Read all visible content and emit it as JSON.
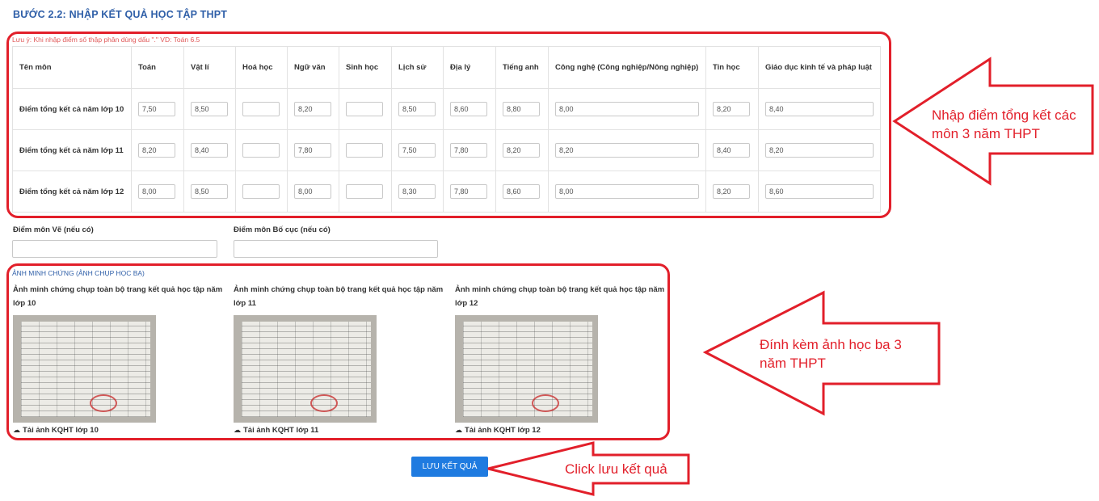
{
  "header": {
    "step_title": "BƯỚC 2.2: NHẬP KẾT QUẢ HỌC TẬP THPT"
  },
  "note": "Lưu ý: Khi nhập điểm số thập phân dùng dấu \".\" VD: Toán 6.5",
  "table": {
    "headers": [
      "Tên môn",
      "Toán",
      "Vật lí",
      "Hoá học",
      "Ngữ văn",
      "Sinh học",
      "Lịch sử",
      "Địa lý",
      "Tiếng anh",
      "Công nghệ (Công nghiệp/Nông nghiệp)",
      "Tin học",
      "Giáo dục kinh tế và pháp luật"
    ],
    "rows": [
      {
        "label": "Điểm tổng kết cả năm lớp 10",
        "values": [
          "7,50",
          "8,50",
          "",
          "8,20",
          "",
          "8,50",
          "8,60",
          "8,80",
          "8,00",
          "8,20",
          "8,40"
        ]
      },
      {
        "label": "Điểm tổng kết cả năm lớp 11",
        "values": [
          "8,20",
          "8,40",
          "",
          "7,80",
          "",
          "7,50",
          "7,80",
          "8,20",
          "8,20",
          "8,40",
          "8,20"
        ]
      },
      {
        "label": "Điểm tổng kết cả năm lớp 12",
        "values": [
          "8,00",
          "8,50",
          "",
          "8,00",
          "",
          "8,30",
          "7,80",
          "8,60",
          "8,00",
          "8,20",
          "8,60"
        ]
      }
    ]
  },
  "extras": {
    "ve_label": "Điểm môn Vẽ (nếu có)",
    "ve_value": "",
    "bocuc_label": "Điểm môn Bố cục (nếu có)",
    "bocuc_value": ""
  },
  "proof": {
    "title": "ẢNH MINH CHỨNG (ẢNH CHỤP HỌC BẠ)",
    "items": [
      {
        "caption": "Ảnh minh chứng chụp toàn bộ trang kết quả học tập năm lớp 10",
        "download_label": "Tải ảnh KQHT lớp 10"
      },
      {
        "caption": "Ảnh minh chứng chụp toàn bộ trang kết quả học tập năm lớp 11",
        "download_label": "Tải ảnh KQHT lớp 11"
      },
      {
        "caption": "Ảnh minh chứng chụp toàn bộ trang kết quả học tập năm lớp 12",
        "download_label": "Tải ảnh KQHT lớp 12"
      }
    ],
    "download_icon": "cloud-upload-icon"
  },
  "actions": {
    "save_label": "LƯU KẾT QUẢ"
  },
  "annotations": {
    "color": "#e21f2a",
    "scores_line1": "Nhập điểm tổng kết các",
    "scores_line2": "môn 3 năm THPT",
    "photos_line1": "Đính kèm ảnh học bạ 3",
    "photos_line2": "năm THPT",
    "save": "Click lưu kết quả"
  },
  "colors": {
    "title_blue": "#2f5fa8",
    "button_blue": "#1f7be0",
    "note_red": "#e05a5a"
  }
}
